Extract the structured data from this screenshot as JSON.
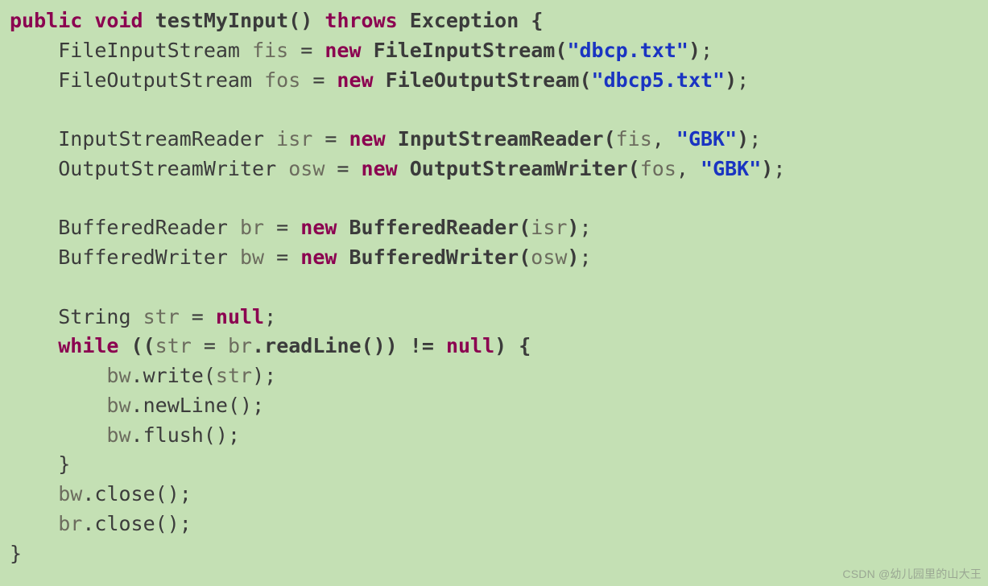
{
  "code": {
    "kw_public": "public",
    "kw_void": "void",
    "method_name": "testMyInput",
    "parens_open_close": "()",
    "kw_throws": "throws",
    "exception": "Exception",
    "brace_open": "{",
    "brace_close": "}",
    "kw_new": "new",
    "kw_null": "null",
    "kw_while": "while",
    "type_FileInputStream": "FileInputStream",
    "type_FileOutputStream": "FileOutputStream",
    "type_InputStreamReader": "InputStreamReader",
    "type_OutputStreamWriter": "OutputStreamWriter",
    "type_BufferedReader": "BufferedReader",
    "type_BufferedWriter": "BufferedWriter",
    "type_String": "String",
    "var_fis": "fis",
    "var_fos": "fos",
    "var_isr": "isr",
    "var_osw": "osw",
    "var_br": "br",
    "var_bw": "bw",
    "var_str": "str",
    "str_dbcp": "\"dbcp.txt\"",
    "str_dbcp5": "\"dbcp5.txt\"",
    "str_gbk": "\"GBK\"",
    "call_readLine": "readLine",
    "call_write": "write",
    "call_newLine": "newLine",
    "call_flush": "flush",
    "call_close": "close",
    "eq": " = ",
    "sc": ";",
    "comma_sp": ", ",
    "lp": "(",
    "rp": ")",
    "dot": ".",
    "neq_null": " != ",
    "assign_in_cond_open": "((",
    "assign_in_cond_mid": " = "
  },
  "watermark": "CSDN @幼儿园里的山大王"
}
